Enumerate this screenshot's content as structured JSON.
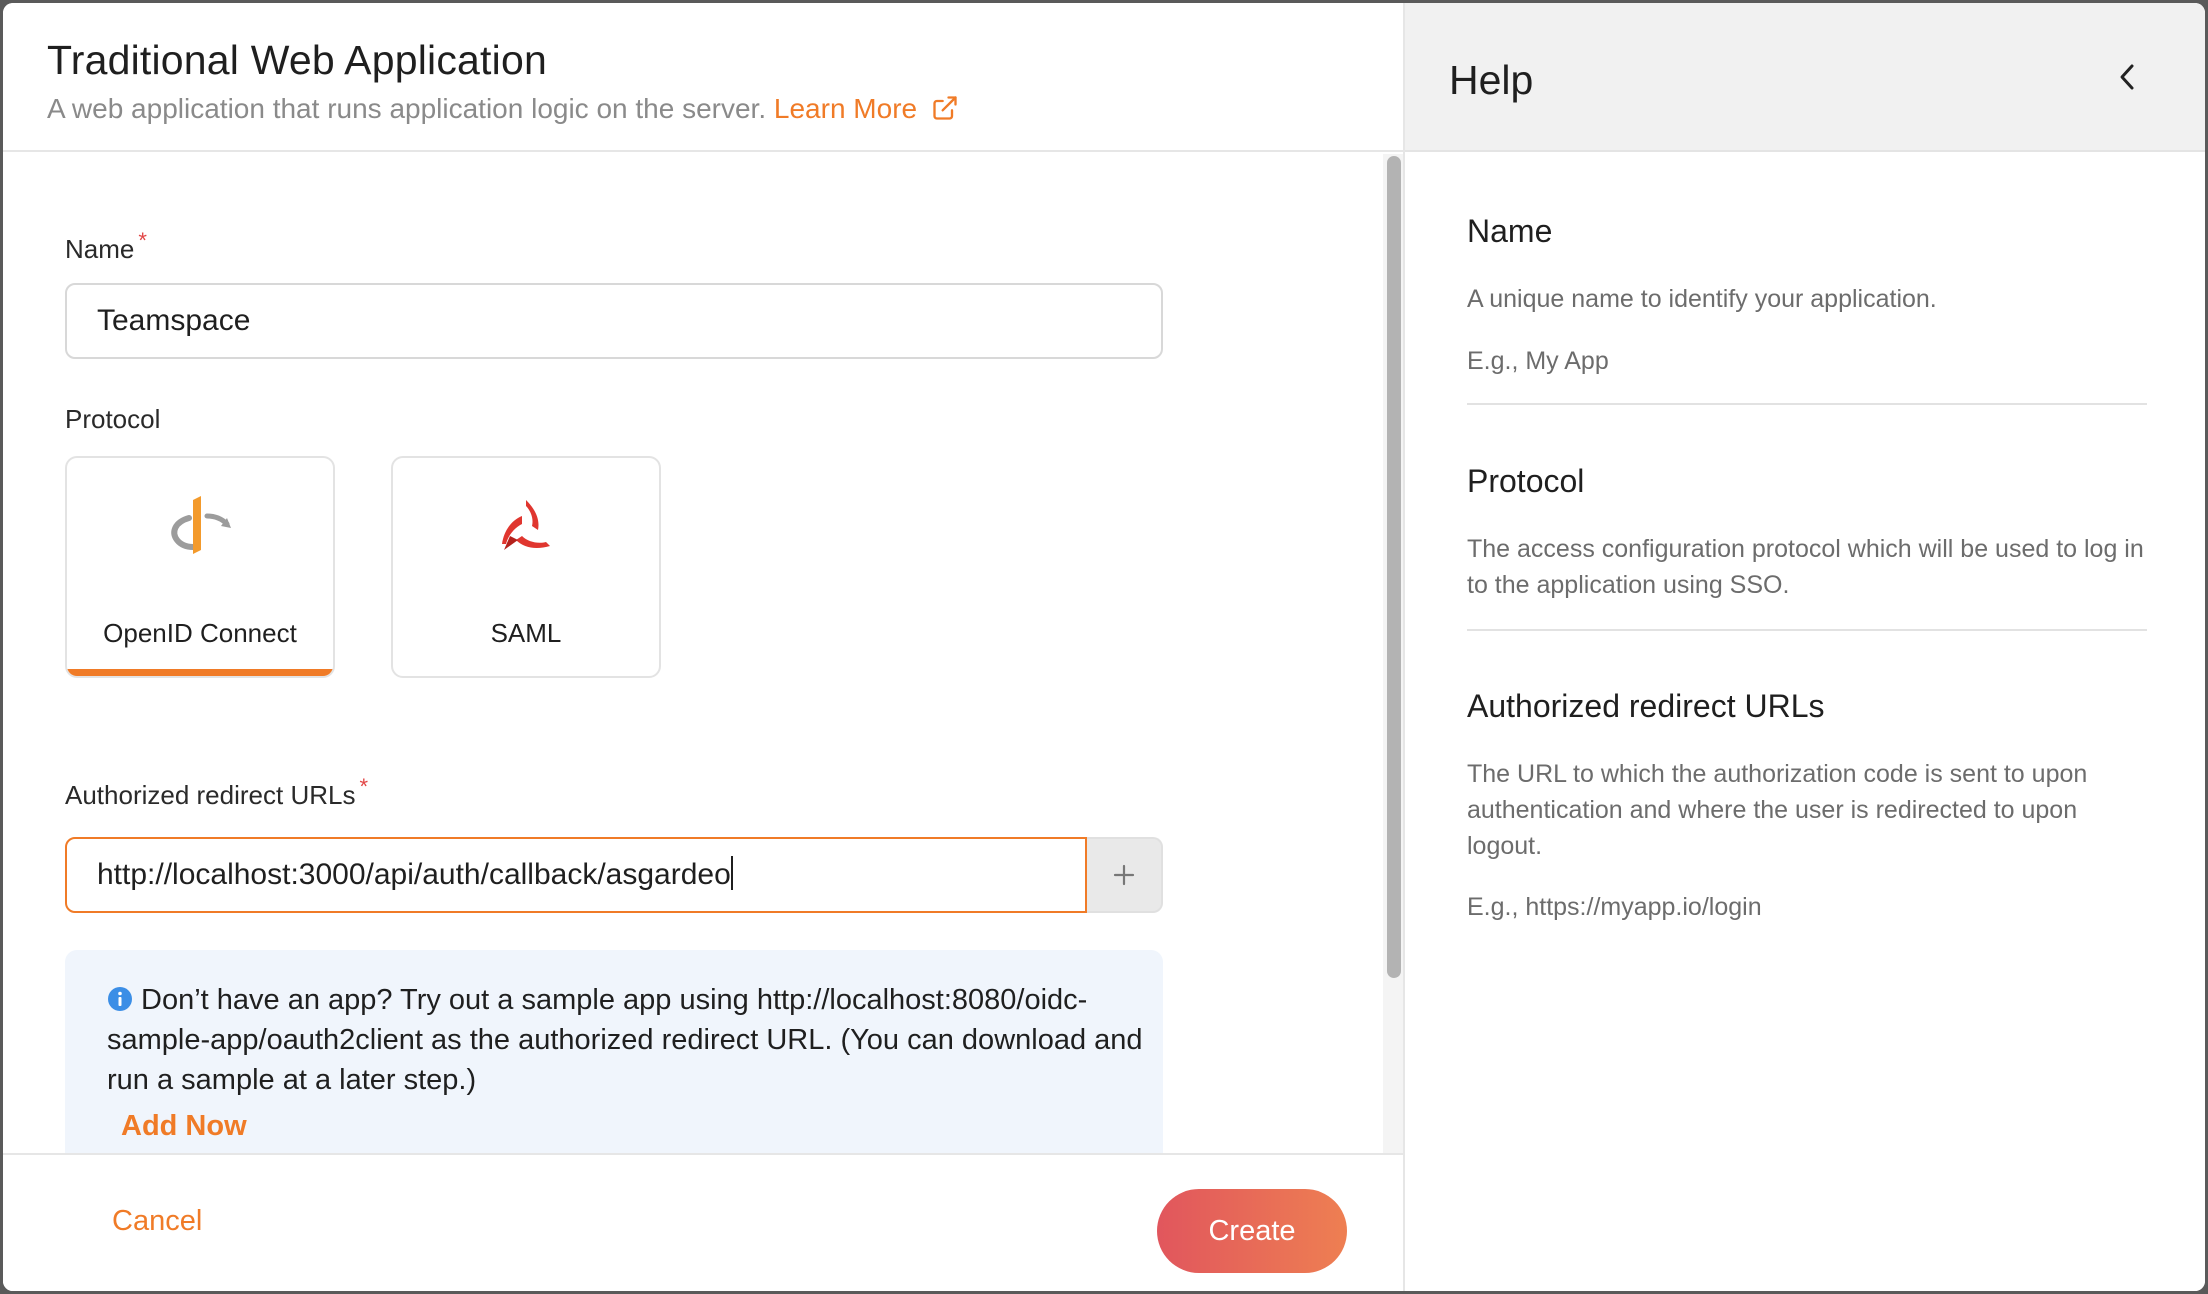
{
  "dialog": {
    "title": "Traditional Web Application",
    "subtitle": "A web application that runs application logic on the server.",
    "learn_more": "Learn More"
  },
  "form": {
    "name_label": "Name",
    "name_required": "*",
    "name_value": "Teamspace",
    "protocol_label": "Protocol",
    "protocols": [
      {
        "label": "OpenID Connect",
        "icon": "openid-connect-logo",
        "selected": true
      },
      {
        "label": "SAML",
        "icon": "saml-logo",
        "selected": false
      }
    ],
    "redirect_label": "Authorized redirect URLs",
    "redirect_required": "*",
    "redirect_value": "http://localhost:3000/api/auth/callback/asgardeo",
    "info_message": "Don’t have an app? Try out a sample app using http://localhost:8080/oidc-sample-app/oauth2client as the authorized redirect URL. (You can download and run a sample at a later step.)",
    "add_now": "Add Now"
  },
  "footer": {
    "cancel": "Cancel",
    "create": "Create"
  },
  "help": {
    "title": "Help",
    "sections": [
      {
        "title": "Name",
        "text": "A unique name to identify your application.",
        "example": "E.g., My App"
      },
      {
        "title": "Protocol",
        "text": "The access configuration protocol which will be used to log in to the application using SSO."
      },
      {
        "title": "Authorized redirect URLs",
        "text": "The URL to which the authorization code is sent to upon authentication and where the user is redirected to upon logout.",
        "example": "E.g., https://myapp.io/login"
      }
    ]
  },
  "colors": {
    "accent": "#f07b27",
    "required": "#e24646",
    "create_gradient_start": "#e1565d",
    "create_gradient_end": "#ee7f52",
    "info_background": "#f0f5fc",
    "info_icon": "#3b8ee6"
  }
}
